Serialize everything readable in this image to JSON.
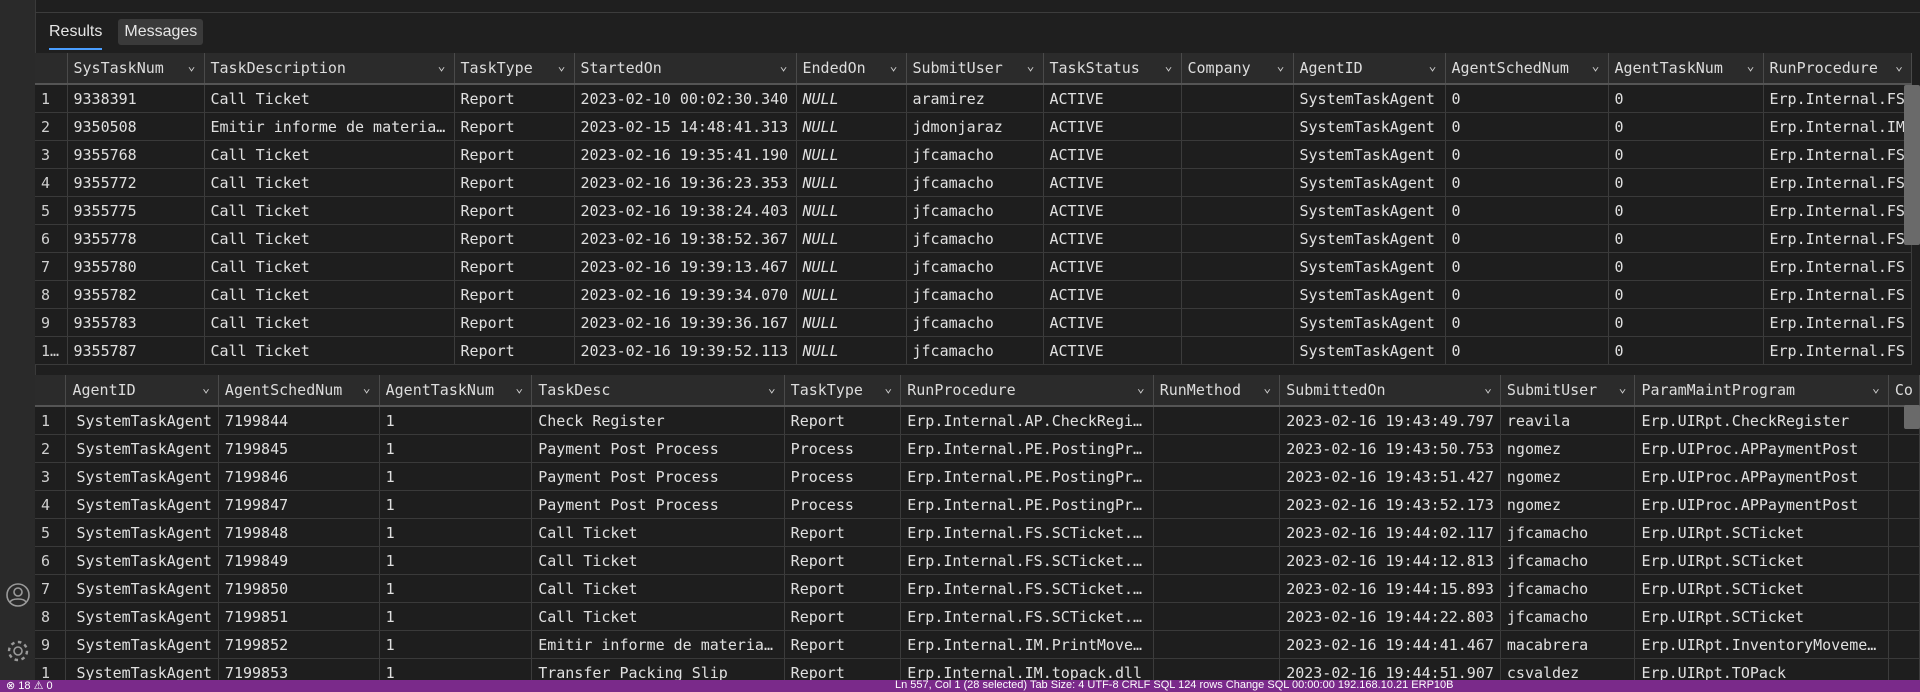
{
  "tabs": [
    {
      "label": "Results",
      "active": true
    },
    {
      "label": "Messages",
      "active": false
    }
  ],
  "grid_top": {
    "columns": [
      "",
      "SysTaskNum",
      "TaskDescription",
      "TaskType",
      "StartedOn",
      "EndedOn",
      "SubmitUser",
      "TaskStatus",
      "Company",
      "AgentID",
      "AgentSchedNum",
      "AgentTaskNum",
      "RunProcedure"
    ],
    "rows": [
      [
        "1",
        "9338391",
        "Call Ticket",
        "Report",
        "2023-02-10 00:02:30.340",
        "NULL",
        "aramirez",
        "ACTIVE",
        "",
        "SystemTaskAgent",
        "0",
        "0",
        "Erp.Internal.FS"
      ],
      [
        "2",
        "9350508",
        "Emitir informe de materia…",
        "Report",
        "2023-02-15 14:48:41.313",
        "NULL",
        "jdmonjaraz",
        "ACTIVE",
        "",
        "SystemTaskAgent",
        "0",
        "0",
        "Erp.Internal.IM"
      ],
      [
        "3",
        "9355768",
        "Call Ticket",
        "Report",
        "2023-02-16 19:35:41.190",
        "NULL",
        "jfcamacho",
        "ACTIVE",
        "",
        "SystemTaskAgent",
        "0",
        "0",
        "Erp.Internal.FS"
      ],
      [
        "4",
        "9355772",
        "Call Ticket",
        "Report",
        "2023-02-16 19:36:23.353",
        "NULL",
        "jfcamacho",
        "ACTIVE",
        "",
        "SystemTaskAgent",
        "0",
        "0",
        "Erp.Internal.FS"
      ],
      [
        "5",
        "9355775",
        "Call Ticket",
        "Report",
        "2023-02-16 19:38:24.403",
        "NULL",
        "jfcamacho",
        "ACTIVE",
        "",
        "SystemTaskAgent",
        "0",
        "0",
        "Erp.Internal.FS"
      ],
      [
        "6",
        "9355778",
        "Call Ticket",
        "Report",
        "2023-02-16 19:38:52.367",
        "NULL",
        "jfcamacho",
        "ACTIVE",
        "",
        "SystemTaskAgent",
        "0",
        "0",
        "Erp.Internal.FS"
      ],
      [
        "7",
        "9355780",
        "Call Ticket",
        "Report",
        "2023-02-16 19:39:13.467",
        "NULL",
        "jfcamacho",
        "ACTIVE",
        "",
        "SystemTaskAgent",
        "0",
        "0",
        "Erp.Internal.FS"
      ],
      [
        "8",
        "9355782",
        "Call Ticket",
        "Report",
        "2023-02-16 19:39:34.070",
        "NULL",
        "jfcamacho",
        "ACTIVE",
        "",
        "SystemTaskAgent",
        "0",
        "0",
        "Erp.Internal.FS"
      ],
      [
        "9",
        "9355783",
        "Call Ticket",
        "Report",
        "2023-02-16 19:39:36.167",
        "NULL",
        "jfcamacho",
        "ACTIVE",
        "",
        "SystemTaskAgent",
        "0",
        "0",
        "Erp.Internal.FS"
      ],
      [
        "1…",
        "9355787",
        "Call Ticket",
        "Report",
        "2023-02-16 19:39:52.113",
        "NULL",
        "jfcamacho",
        "ACTIVE",
        "",
        "SystemTaskAgent",
        "0",
        "0",
        "Erp.Internal.FS"
      ]
    ]
  },
  "grid_bottom": {
    "columns": [
      "",
      "AgentID",
      "AgentSchedNum",
      "AgentTaskNum",
      "TaskDesc",
      "TaskType",
      "RunProcedure",
      "RunMethod",
      "SubmittedOn",
      "SubmitUser",
      "ParamMaintProgram",
      "Co"
    ],
    "rows": [
      [
        "1",
        "SystemTaskAgent",
        "7199844",
        "1",
        "Check Register",
        "Report",
        "Erp.Internal.AP.CheckRegi…",
        "",
        "2023-02-16 19:43:49.797",
        "reavila",
        "Erp.UIRpt.CheckRegister",
        ""
      ],
      [
        "2",
        "SystemTaskAgent",
        "7199845",
        "1",
        "Payment Post Process",
        "Process",
        "Erp.Internal.PE.PostingPr…",
        "",
        "2023-02-16 19:43:50.753",
        "ngomez",
        "Erp.UIProc.APPaymentPost",
        ""
      ],
      [
        "3",
        "SystemTaskAgent",
        "7199846",
        "1",
        "Payment Post Process",
        "Process",
        "Erp.Internal.PE.PostingPr…",
        "",
        "2023-02-16 19:43:51.427",
        "ngomez",
        "Erp.UIProc.APPaymentPost",
        ""
      ],
      [
        "4",
        "SystemTaskAgent",
        "7199847",
        "1",
        "Payment Post Process",
        "Process",
        "Erp.Internal.PE.PostingPr…",
        "",
        "2023-02-16 19:43:52.173",
        "ngomez",
        "Erp.UIProc.APPaymentPost",
        ""
      ],
      [
        "5",
        "SystemTaskAgent",
        "7199848",
        "1",
        "Call Ticket",
        "Report",
        "Erp.Internal.FS.SCTicket.…",
        "",
        "2023-02-16 19:44:02.117",
        "jfcamacho",
        "Erp.UIRpt.SCTicket",
        ""
      ],
      [
        "6",
        "SystemTaskAgent",
        "7199849",
        "1",
        "Call Ticket",
        "Report",
        "Erp.Internal.FS.SCTicket.…",
        "",
        "2023-02-16 19:44:12.813",
        "jfcamacho",
        "Erp.UIRpt.SCTicket",
        ""
      ],
      [
        "7",
        "SystemTaskAgent",
        "7199850",
        "1",
        "Call Ticket",
        "Report",
        "Erp.Internal.FS.SCTicket.…",
        "",
        "2023-02-16 19:44:15.893",
        "jfcamacho",
        "Erp.UIRpt.SCTicket",
        ""
      ],
      [
        "8",
        "SystemTaskAgent",
        "7199851",
        "1",
        "Call Ticket",
        "Report",
        "Erp.Internal.FS.SCTicket.…",
        "",
        "2023-02-16 19:44:22.803",
        "jfcamacho",
        "Erp.UIRpt.SCTicket",
        ""
      ],
      [
        "9",
        "SystemTaskAgent",
        "7199852",
        "1",
        "Emitir informe de materia…",
        "Report",
        "Erp.Internal.IM.PrintMove…",
        "",
        "2023-02-16 19:44:41.467",
        "macabrera",
        "Erp.UIRpt.InventoryMoveme…",
        ""
      ],
      [
        "1",
        "SystemTaskAgent",
        "7199853",
        "1",
        "Transfer Packing Slip",
        "Report",
        "Erp.Internal.IM.topack.dll",
        "",
        "2023-02-16 19:44:51.907",
        "csvaldez",
        "Erp.UIRpt.TOPack",
        ""
      ]
    ]
  },
  "icons": {
    "account": "account-icon",
    "settings": "gear-icon",
    "column_menu": "chevron-down-icon"
  },
  "statusbar": {
    "left": "⊗ 18 ⚠ 0",
    "right": "Ln 557, Col 1 (28 selected)   Tab Size: 4   UTF-8   CRLF   SQL   124 rows   Change SQL   00:00:00   192.168.10.21   ERP10B"
  },
  "colors": {
    "statusbar": "#7a2a8a",
    "active_tab_underline": "#4a9eff",
    "background": "#1f1f1f"
  }
}
